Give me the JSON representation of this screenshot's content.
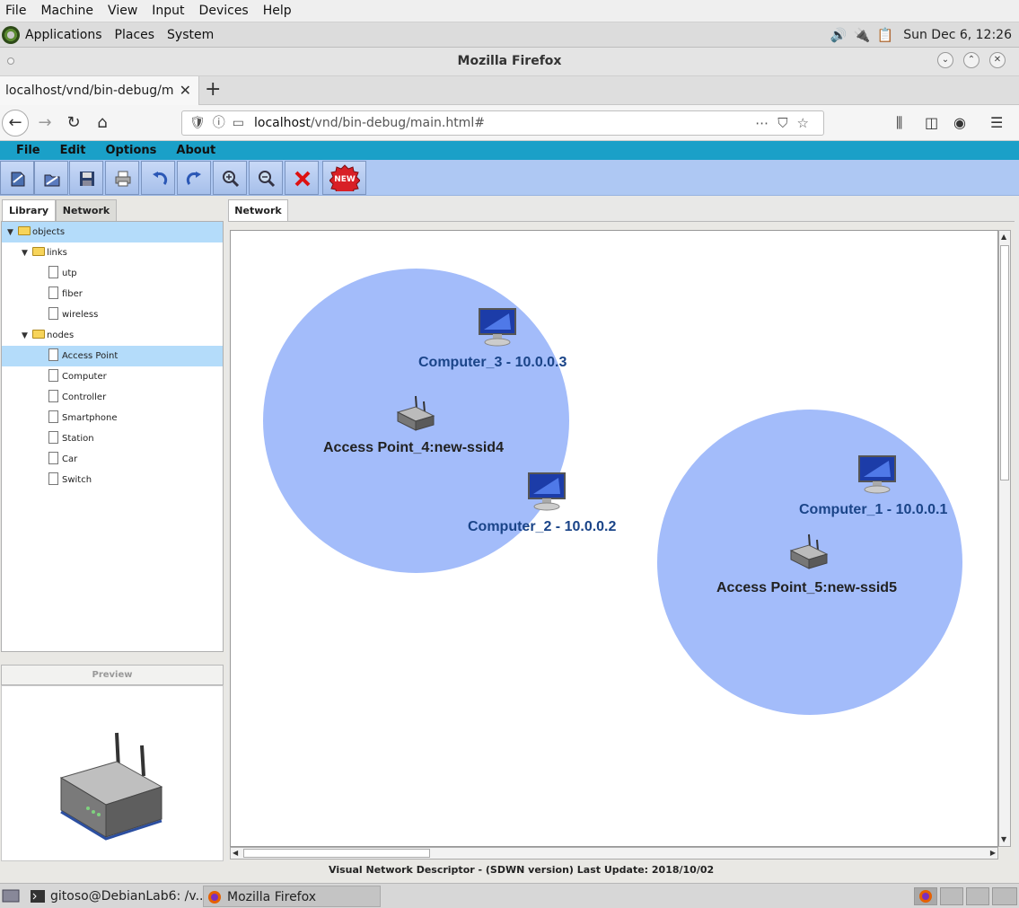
{
  "vm_menu": [
    "File",
    "Machine",
    "View",
    "Input",
    "Devices",
    "Help"
  ],
  "gnome_panel": {
    "menus": [
      "Applications",
      "Places",
      "System"
    ],
    "clock": "Sun Dec  6, 12:26"
  },
  "firefox": {
    "window_title": "Mozilla Firefox",
    "tab_title": "localhost/vnd/bin-debug/main.html#",
    "url_host": "localhost",
    "url_path": "/vnd/bin-debug/main.html#"
  },
  "app_menu": [
    "File",
    "Edit",
    "Options",
    "About"
  ],
  "toolbar": {
    "new_badge": "NEW"
  },
  "left_panel": {
    "tabs": [
      "Library",
      "Network"
    ],
    "tree": {
      "root": "objects",
      "links_folder": "links",
      "links": [
        "utp",
        "fiber",
        "wireless"
      ],
      "nodes_folder": "nodes",
      "nodes": [
        "Access Point",
        "Computer",
        "Controller",
        "Smartphone",
        "Station",
        "Car",
        "Switch"
      ],
      "selected": "Access Point"
    },
    "preview_label": "Preview"
  },
  "network_panel": {
    "tab": "Network",
    "nodes": [
      {
        "type": "computer",
        "label": "Computer_3 - 10.0.0.3"
      },
      {
        "type": "access_point",
        "label": "Access Point_4:new-ssid4"
      },
      {
        "type": "computer",
        "label": "Computer_2 - 10.0.0.2"
      },
      {
        "type": "computer",
        "label": "Computer_1 - 10.0.0.1"
      },
      {
        "type": "access_point",
        "label": "Access Point_5:new-ssid5"
      }
    ],
    "coverage_color": "#a3bcfa"
  },
  "status_text": "Visual Network Descriptor - (SDWN version)  Last Update: 2018/10/02",
  "taskbar": {
    "items": [
      "gitoso@DebianLab6: /v...",
      "Mozilla Firefox"
    ]
  }
}
